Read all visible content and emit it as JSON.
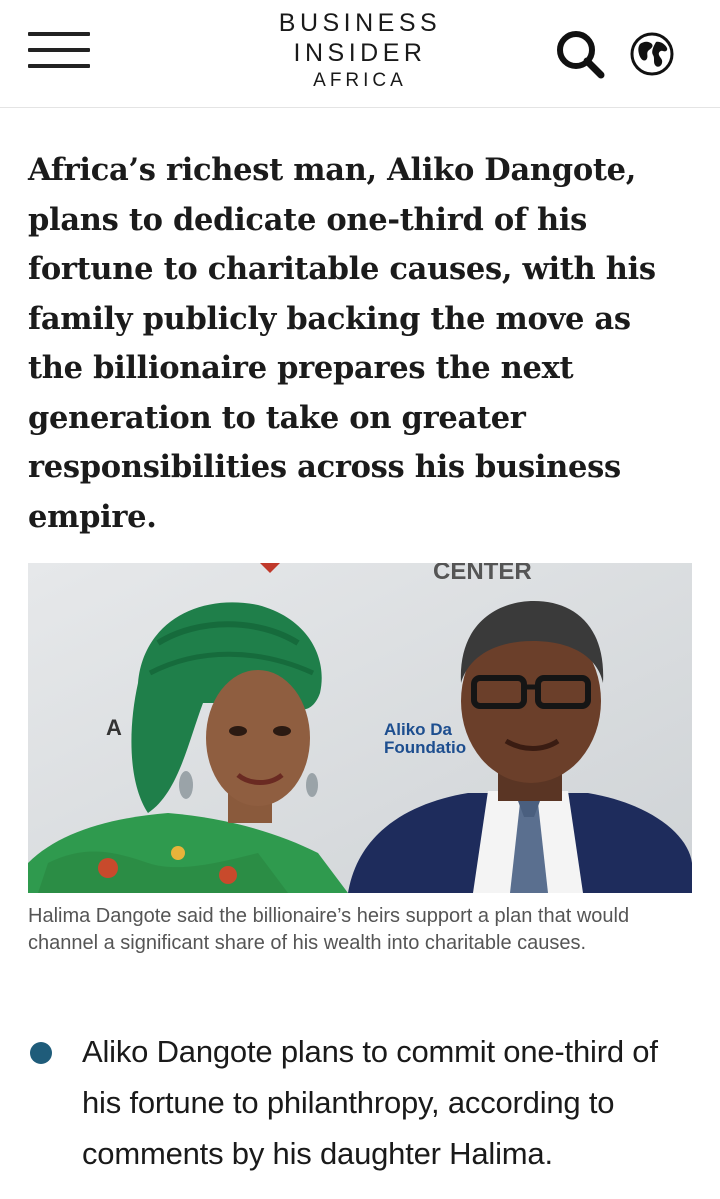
{
  "header": {
    "logo_line1": "BUSINESS",
    "logo_line2": "INSIDER",
    "logo_line3": "AFRICA",
    "menu_icon": "hamburger-menu-icon",
    "search_icon": "search-icon",
    "edition_icon": "globe-icon"
  },
  "article": {
    "headline": "Africa’s richest man, Aliko Dangote, plans to dedicate one-third of his fortune to charitable causes, with his family publicly backing the move as the billionaire prepares the next generation to take on greater responsibilities across his business empire.",
    "photo": {
      "backdrop_text_top": "CENTER",
      "backdrop_text_left": "A",
      "backdrop_logo_line1": "Aliko Da",
      "backdrop_logo_line2": "Foundatio"
    },
    "caption": "Halima Dangote said the billionaire’s heirs support a plan that would channel a significant share of his wealth into charitable causes.",
    "bullets": [
      "Aliko Dangote plans to commit one-third of his fortune to philanthropy, according to comments by his daughter Halima."
    ]
  },
  "colors": {
    "bullet": "#1f5c7a",
    "text": "#1a1a1a",
    "caption": "#555555",
    "foundation_logo": "#1d4e8f"
  }
}
